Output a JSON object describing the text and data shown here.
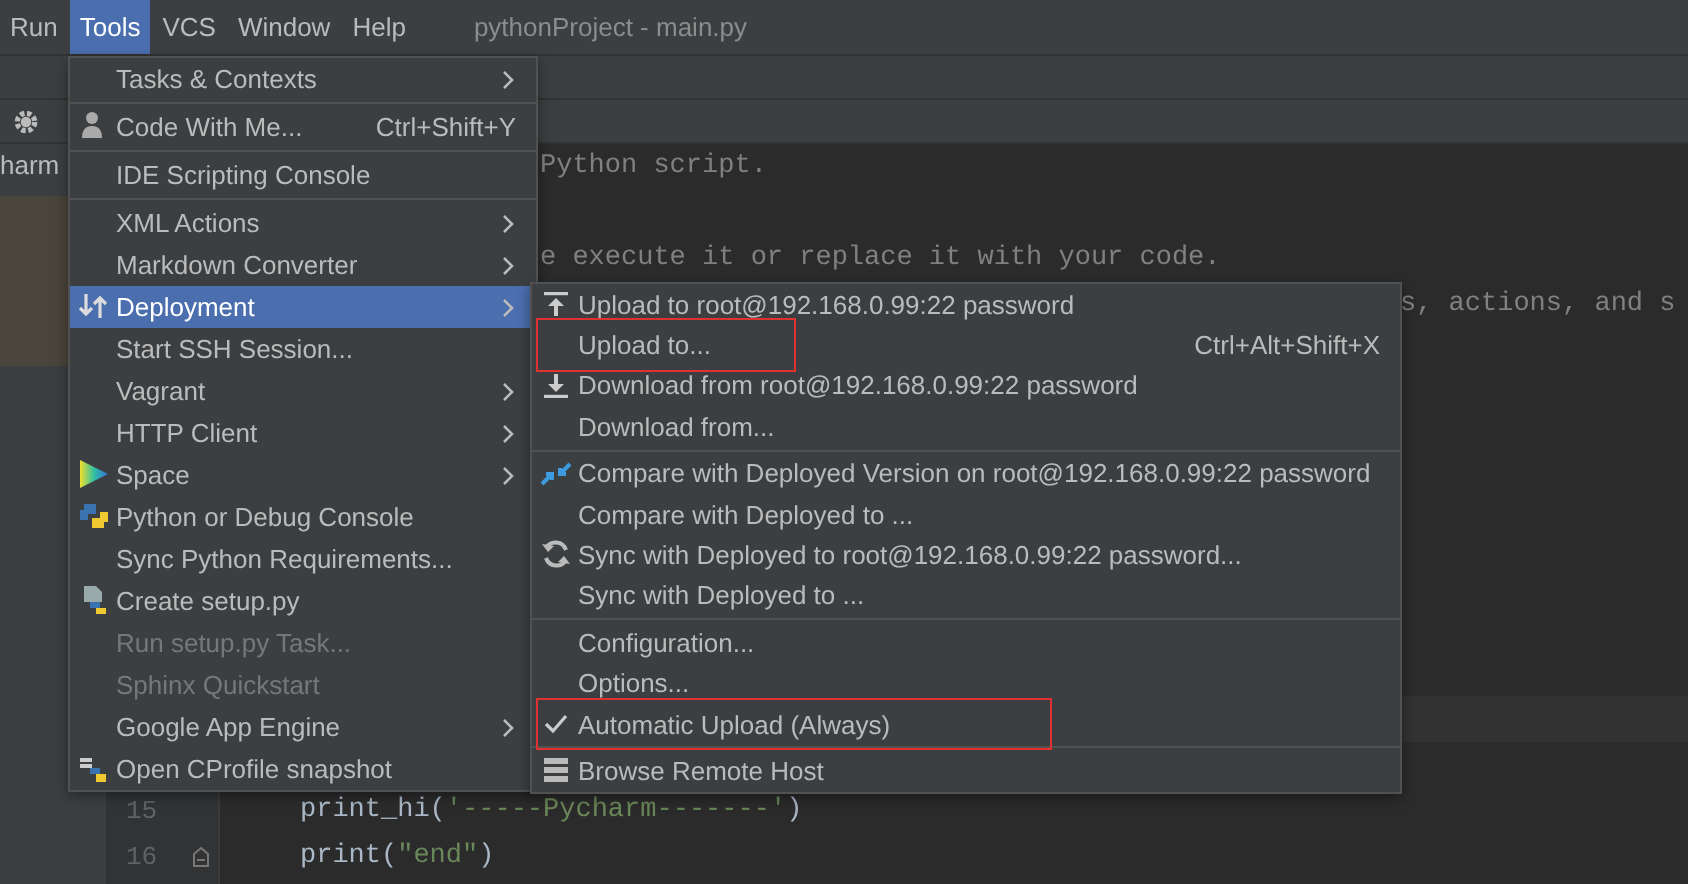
{
  "window": {
    "title": "pythonProject - main.py"
  },
  "menu_bar": [
    {
      "label": "Run",
      "selected": false
    },
    {
      "label": "Tools",
      "selected": true
    },
    {
      "label": "VCS",
      "selected": false
    },
    {
      "label": "Window",
      "selected": false
    },
    {
      "label": "Help",
      "selected": false
    }
  ],
  "project_panel": {
    "item": "harm"
  },
  "editor": {
    "lines": [
      {
        "kind": "after-menu",
        "text": "Python script."
      },
      {
        "kind": "blank"
      },
      {
        "kind": "after-menu",
        "text": "e execute it or replace it with your code."
      },
      {
        "kind": "after-submenu",
        "text": "s, actions, and s"
      },
      {
        "kind": "blank"
      },
      {
        "kind": "blank"
      },
      {
        "kind": "blank"
      },
      {
        "kind": "blank"
      },
      {
        "kind": "blank"
      },
      {
        "kind": "blank"
      },
      {
        "kind": "blank"
      },
      {
        "kind": "blank"
      },
      {
        "kind": "current"
      },
      {
        "kind": "blank"
      },
      {
        "kind": "code",
        "number": "15",
        "text": "print_hi('-----Pycharm-------')"
      },
      {
        "kind": "code",
        "number": "16",
        "text": "print(\"end\")"
      }
    ]
  },
  "tools_menu": {
    "sections": [
      [
        {
          "kind": "plain",
          "label": "Tasks & Contexts",
          "submenu": true,
          "selected": false,
          "disabled": false
        }
      ],
      [
        {
          "kind": "person",
          "label": "Code With Me...",
          "shortcut": "Ctrl+Shift+Y",
          "submenu": false,
          "selected": false,
          "disabled": false
        }
      ],
      [
        {
          "kind": "plain",
          "label": "IDE Scripting Console",
          "submenu": false,
          "selected": false,
          "disabled": false
        }
      ],
      [
        {
          "kind": "plain",
          "label": "XML Actions",
          "submenu": true,
          "selected": false,
          "disabled": false
        },
        {
          "kind": "plain",
          "label": "Markdown Converter",
          "submenu": true,
          "selected": false,
          "disabled": false
        },
        {
          "kind": "transfer",
          "label": "Deployment",
          "submenu": true,
          "selected": true,
          "disabled": false
        },
        {
          "kind": "plain",
          "label": "Start SSH Session...",
          "submenu": false,
          "selected": false,
          "disabled": false
        },
        {
          "kind": "plain",
          "label": "Vagrant",
          "submenu": true,
          "selected": false,
          "disabled": false
        },
        {
          "kind": "plain",
          "label": "HTTP Client",
          "submenu": true,
          "selected": false,
          "disabled": false
        },
        {
          "kind": "triangle",
          "label": "Space",
          "submenu": true,
          "selected": false,
          "disabled": false
        },
        {
          "kind": "python",
          "label": "Python or Debug Console",
          "submenu": false,
          "selected": false,
          "disabled": false
        },
        {
          "kind": "plain",
          "label": "Sync Python Requirements...",
          "submenu": false,
          "selected": false,
          "disabled": false
        },
        {
          "kind": "pyfile",
          "label": "Create setup.py",
          "submenu": false,
          "selected": false,
          "disabled": false
        },
        {
          "kind": "plain",
          "label": "Run setup.py Task...",
          "submenu": false,
          "selected": false,
          "disabled": true
        },
        {
          "kind": "plain",
          "label": "Sphinx Quickstart",
          "submenu": false,
          "selected": false,
          "disabled": true
        },
        {
          "kind": "plain",
          "label": "Google App Engine",
          "submenu": true,
          "selected": false,
          "disabled": false
        },
        {
          "kind": "pyplug",
          "label": "Open CProfile snapshot",
          "submenu": false,
          "selected": false,
          "disabled": false
        }
      ]
    ]
  },
  "deployment_menu": {
    "sections": [
      [
        {
          "kind": "upload",
          "label": "Upload to root@192.168.0.99:22 password",
          "checked": false,
          "highlighted": false
        },
        {
          "kind": "plain",
          "label": "Upload to...",
          "shortcut": "Ctrl+Alt+Shift+X",
          "checked": false,
          "highlighted": true
        },
        {
          "kind": "download",
          "label": "Download from root@192.168.0.99:22 password",
          "checked": false,
          "highlighted": false
        },
        {
          "kind": "plain",
          "label": "Download from...",
          "checked": false,
          "highlighted": false
        }
      ],
      [
        {
          "kind": "compare",
          "label": "Compare with Deployed Version on root@192.168.0.99:22 password",
          "checked": false,
          "highlighted": false
        },
        {
          "kind": "plain",
          "label": "Compare with Deployed to ...",
          "checked": false,
          "highlighted": false
        },
        {
          "kind": "sync",
          "label": "Sync with Deployed to root@192.168.0.99:22 password...",
          "checked": false,
          "highlighted": false
        },
        {
          "kind": "plain",
          "label": "Sync with Deployed to ...",
          "checked": false,
          "highlighted": false
        }
      ],
      [
        {
          "kind": "plain",
          "label": "Configuration...",
          "checked": false,
          "highlighted": false
        },
        {
          "kind": "plain",
          "label": "Options...",
          "checked": false,
          "highlighted": false
        },
        {
          "kind": "plain",
          "label": "Automatic Upload (Always)",
          "checked": true,
          "highlighted": true
        }
      ],
      [
        {
          "kind": "server",
          "label": "Browse Remote Host",
          "checked": false,
          "highlighted": false
        }
      ]
    ]
  }
}
